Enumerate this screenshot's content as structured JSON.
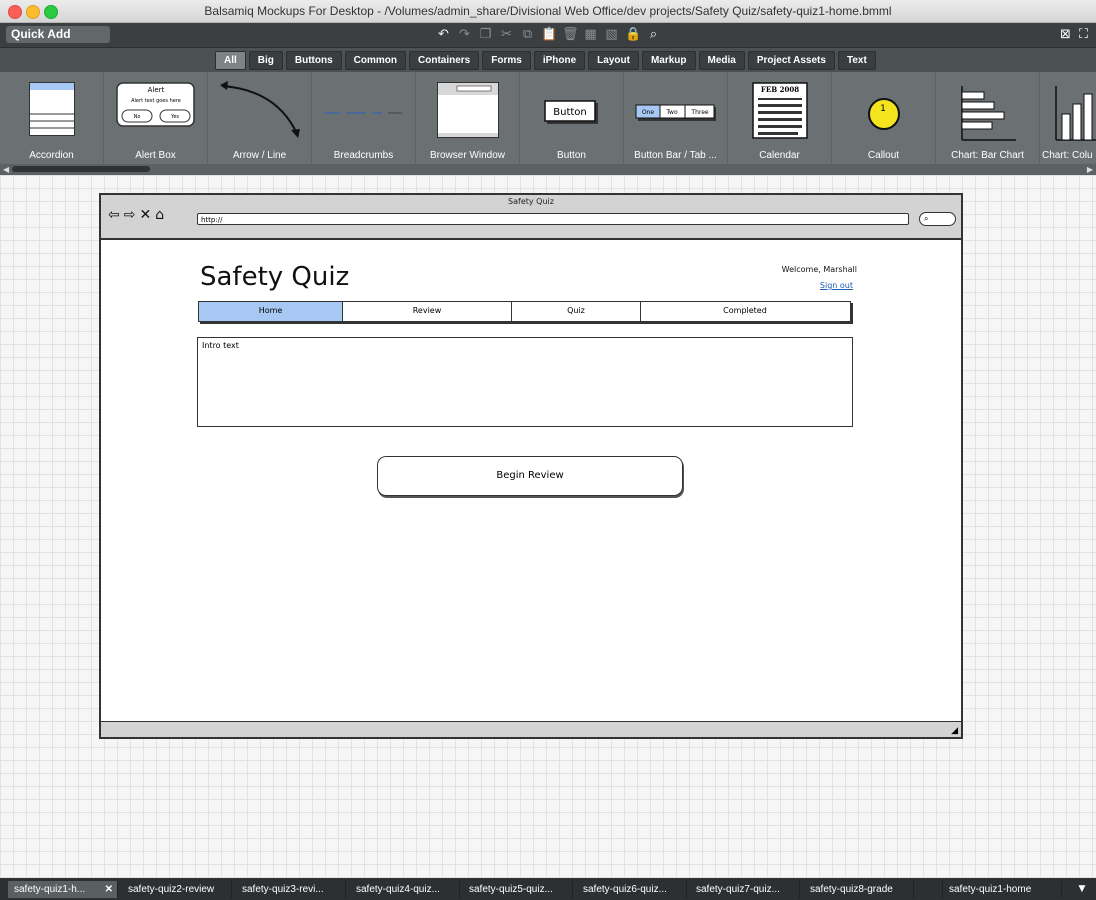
{
  "window": {
    "title": "Balsamiq Mockups For Desktop - /Volumes/admin_share/Divisional Web Office/dev projects/Safety Quiz/safety-quiz1-home.bmml"
  },
  "toolbar": {
    "quick_add": "Quick Add",
    "icons": [
      "undo-icon",
      "redo-icon",
      "copy-icon",
      "cut-icon",
      "duplicate-icon",
      "paste-icon",
      "delete-icon",
      "group-icon",
      "ungroup-icon",
      "lock-icon",
      "search-icon"
    ],
    "window_icons": [
      "close-view-icon",
      "fullscreen-icon"
    ]
  },
  "categories": {
    "items": [
      "All",
      "Big",
      "Buttons",
      "Common",
      "Containers",
      "Forms",
      "iPhone",
      "Layout",
      "Markup",
      "Media",
      "Project Assets",
      "Text"
    ],
    "active": "All"
  },
  "library": {
    "items": [
      "Accordion",
      "Alert Box",
      "Arrow / Line",
      "Breadcrumbs",
      "Browser Window",
      "Button",
      "Button Bar / Tab ...",
      "Calendar",
      "Callout",
      "Chart: Bar Chart",
      "Chart: Colu"
    ],
    "thumb_text": {
      "alert_title": "Alert",
      "alert_body": "Alert text goes here",
      "alert_no": "No",
      "alert_yes": "Yes",
      "button": "Button",
      "bar_one": "One",
      "bar_two": "Two",
      "bar_three": "Three",
      "calendar_month": "FEB 2008",
      "callout_num": "1"
    }
  },
  "mockup": {
    "window_title": "Safety Quiz",
    "url": "http://",
    "page_title": "Safety Quiz",
    "welcome": "Welcome, Marshall",
    "signout": "Sign out",
    "tabs": [
      {
        "label": "Home",
        "selected": true
      },
      {
        "label": "Review",
        "selected": false
      },
      {
        "label": "Quiz",
        "selected": false
      },
      {
        "label": "Completed",
        "selected": false
      }
    ],
    "intro": "Intro text",
    "begin_button": "Begin Review"
  },
  "bottom_tabs": {
    "items": [
      "safety-quiz1-h...",
      "safety-quiz2-review",
      "safety-quiz3-revi...",
      "safety-quiz4-quiz...",
      "safety-quiz5-quiz...",
      "safety-quiz6-quiz...",
      "safety-quiz7-quiz...",
      "safety-quiz8-grade"
    ],
    "active_index": 0,
    "current": "safety-quiz1-home"
  }
}
